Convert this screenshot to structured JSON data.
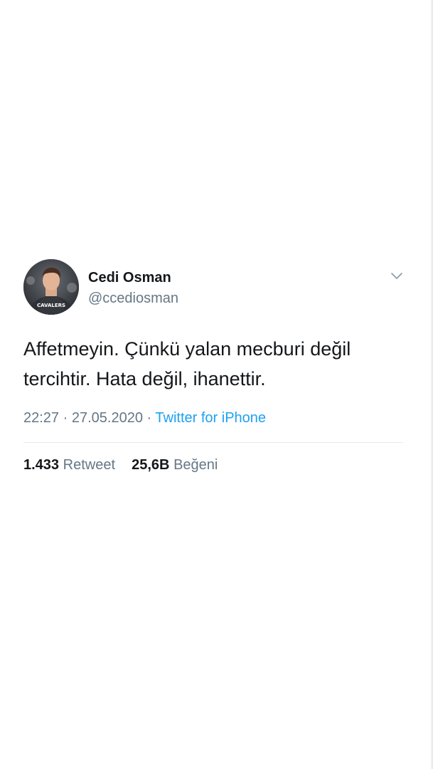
{
  "tweet": {
    "author": {
      "display_name": "Cedi Osman",
      "handle": "@ccediosman",
      "avatar_jersey_text": "CAVALERS"
    },
    "text": "Affetmeyin. Çünkü yalan mecburi değil tercihtir. Hata değil, ihanettir.",
    "time": "22:27",
    "date": "27.05.2020",
    "separator": "·",
    "source": "Twitter for iPhone",
    "stats": {
      "retweets": "1.433",
      "retweets_label": "Retweet",
      "likes": "25,6B",
      "likes_label": "Beğeni"
    }
  },
  "icons": {
    "menu": "chevron-down-icon"
  },
  "colors": {
    "text_primary": "#14171a",
    "text_secondary": "#657786",
    "link": "#1da1f2",
    "divider": "#e1e8ed"
  }
}
